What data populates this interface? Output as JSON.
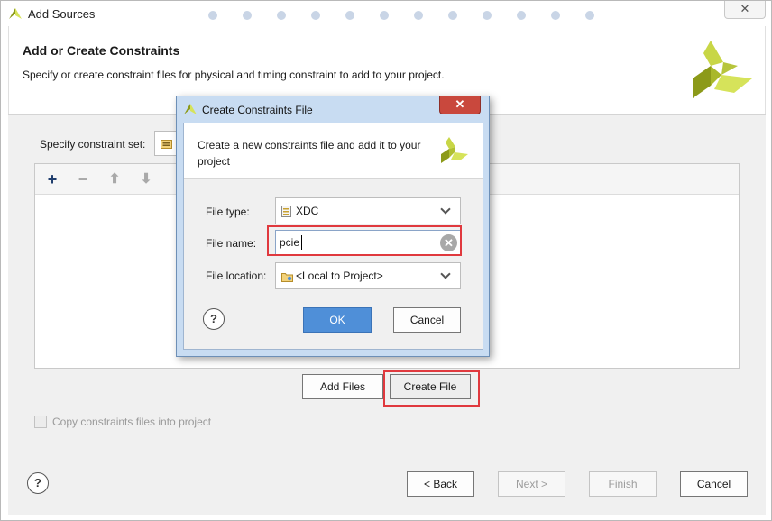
{
  "window": {
    "title": "Add Sources",
    "close_label": "✕",
    "header_title": "Add or Create Constraints",
    "header_description": "Specify or create constraint files for physical and timing constraint to add to your project."
  },
  "constraint_set": {
    "label": "Specify constraint set:"
  },
  "table_toolbar": {
    "add": "+",
    "remove": "−",
    "up": "⬆",
    "down": "⬇"
  },
  "actions": {
    "add_files": "Add Files",
    "create_file": "Create File"
  },
  "copy_checkbox": {
    "label": "Copy constraints files into project",
    "checked": false
  },
  "footer": {
    "help": "?",
    "back": "< Back",
    "next": "Next >",
    "finish": "Finish",
    "cancel": "Cancel"
  },
  "dialog": {
    "title": "Create Constraints File",
    "close_label": "✕",
    "description": "Create a new constraints file and add it to your project",
    "file_type_label": "File type:",
    "file_type_value": "XDC",
    "file_name_label": "File name:",
    "file_name_value": "pcie",
    "file_location_label": "File location:",
    "file_location_value": "<Local to Project>",
    "help": "?",
    "ok": "OK",
    "cancel": "Cancel"
  },
  "colors": {
    "accent_red": "#e0393e",
    "ok_blue": "#4f8fd8",
    "logo_dark": "#8c9a19",
    "logo_light": "#d6e35a"
  }
}
